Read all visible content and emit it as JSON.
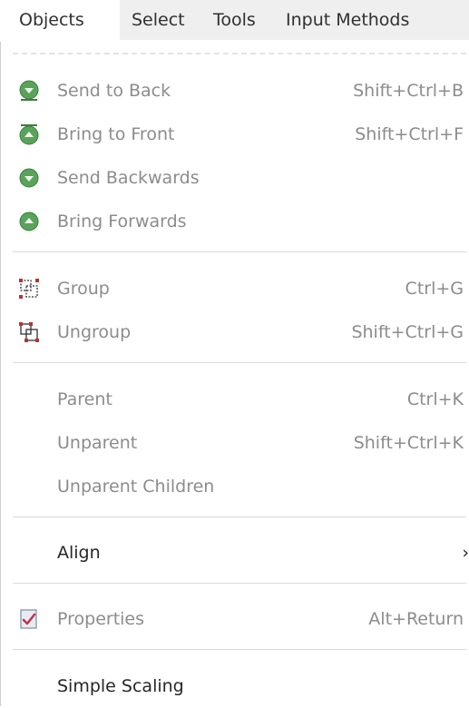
{
  "menubar": {
    "items": [
      {
        "label": "Objects"
      },
      {
        "label": "Select"
      },
      {
        "label": "Tools"
      },
      {
        "label": "Input Methods"
      }
    ]
  },
  "menu": {
    "items": [
      {
        "label": "Send to Back",
        "shortcut": "Shift+Ctrl+B",
        "icon": "send-to-back-icon",
        "enabled": false
      },
      {
        "label": "Bring to Front",
        "shortcut": "Shift+Ctrl+F",
        "icon": "bring-to-front-icon",
        "enabled": false
      },
      {
        "label": "Send Backwards",
        "shortcut": "",
        "icon": "send-backwards-icon",
        "enabled": false
      },
      {
        "label": "Bring Forwards",
        "shortcut": "",
        "icon": "bring-forwards-icon",
        "enabled": false
      },
      {
        "label": "Group",
        "shortcut": "Ctrl+G",
        "icon": "group-icon",
        "enabled": false
      },
      {
        "label": "Ungroup",
        "shortcut": "Shift+Ctrl+G",
        "icon": "ungroup-icon",
        "enabled": false
      },
      {
        "label": "Parent",
        "shortcut": "Ctrl+K",
        "enabled": false
      },
      {
        "label": "Unparent",
        "shortcut": "Shift+Ctrl+K",
        "enabled": false
      },
      {
        "label": "Unparent Children",
        "shortcut": "",
        "enabled": false
      },
      {
        "label": "Align",
        "shortcut": "",
        "enabled": true,
        "submenu": true
      },
      {
        "label": "Properties",
        "shortcut": "Alt+Return",
        "icon": "properties-icon",
        "enabled": false
      },
      {
        "label": "Simple Scaling",
        "shortcut": "",
        "enabled": true
      }
    ]
  },
  "colors": {
    "disabled_text": "#8c8c8c",
    "enabled_text": "#262626",
    "icon_green": "#4f9a4f",
    "menubar_inactive_bg": "#efefef"
  }
}
